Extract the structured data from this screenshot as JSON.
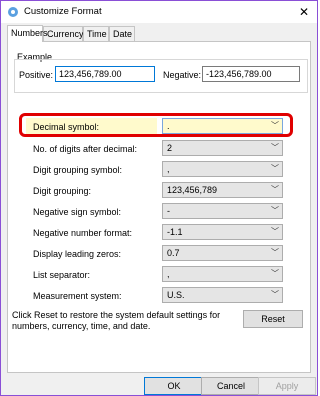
{
  "window": {
    "title": "Customize Format",
    "close_glyph": "✕"
  },
  "tabs": [
    "Numbers",
    "Currency",
    "Time",
    "Date"
  ],
  "example": {
    "label": "Example",
    "positive_label": "Positive:",
    "positive_value": "123,456,789.00",
    "negative_label": "Negative:",
    "negative_value": "-123,456,789.00"
  },
  "settings": [
    {
      "label": "Decimal symbol:",
      "value": "."
    },
    {
      "label": "No. of digits after decimal:",
      "value": "2"
    },
    {
      "label": "Digit grouping symbol:",
      "value": ","
    },
    {
      "label": "Digit grouping:",
      "value": "123,456,789"
    },
    {
      "label": "Negative sign symbol:",
      "value": "-"
    },
    {
      "label": "Negative number format:",
      "value": "-1.1"
    },
    {
      "label": "Display leading zeros:",
      "value": "0.7"
    },
    {
      "label": "List separator:",
      "value": ","
    },
    {
      "label": "Measurement system:",
      "value": "U.S."
    }
  ],
  "reset_note": "Click Reset to restore the system default settings for numbers, currency, time, and date.",
  "buttons": {
    "reset": "Reset",
    "ok": "OK",
    "cancel": "Cancel",
    "apply": "Apply"
  },
  "icons": {
    "app": "gear-icon",
    "chevron": "chevron-down-icon"
  },
  "colors": {
    "highlight_border": "#e00000",
    "focus_border": "#0078d7",
    "title_accent": "#8a4fd6"
  }
}
